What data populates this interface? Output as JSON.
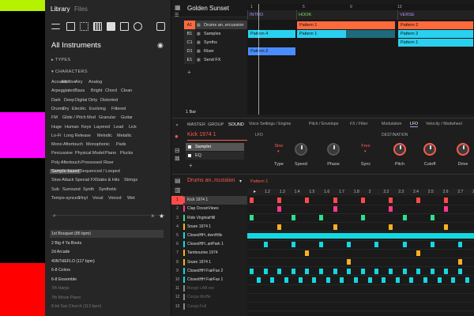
{
  "strip": {
    "colors": [
      "#b6f100",
      "#000000",
      "#ff00ff",
      "#000000",
      "#ff0000",
      "#000000"
    ]
  },
  "library": {
    "tabs": [
      "Library",
      "Files"
    ],
    "title": "All Instruments",
    "types_label": "TYPES",
    "characters_label": "CHARACTERS",
    "tags": [
      [
        "Acoustic",
        "Additive",
        "Airy",
        "Analog"
      ],
      [
        "Arpeggiated",
        "Bass",
        "Bright",
        "Chord",
        "Clean"
      ],
      [
        "Dark",
        "Deep",
        "Digital",
        "Dirty",
        "Distorted"
      ],
      [
        "Drums",
        "Dry",
        "Electric",
        "Evolving",
        "Filtered"
      ],
      [
        "FM",
        "Glide / Pitch Mod",
        "Granular",
        "Guitar"
      ],
      [
        "Huge",
        "Human",
        "Keys",
        "Layered",
        "Lead",
        "Lick"
      ],
      [
        "Lo-Fi",
        "Long Release",
        "Melodic",
        "Metallic"
      ],
      [
        "Mono Aftertouch",
        "Monophonic",
        "Pads"
      ],
      [
        "Percussive",
        "Physical Model",
        "Piano",
        "Plucks"
      ],
      [
        "Poly Aftertouch",
        "Processed",
        "Riser"
      ],
      [
        "Sample-based",
        "Sequenced / Looped"
      ],
      [
        "Slow Attack",
        "Special FX",
        "Stabs & Hits",
        "Strings"
      ],
      [
        "Sub",
        "Surround",
        "Synth",
        "Synthetic"
      ],
      [
        "Tempo-synced",
        "Vinyl",
        "Vocal",
        "Voiced",
        "Wet"
      ]
    ],
    "selected_tag": "Sample-based",
    "results": [
      {
        "name": "1st Bouquet (85 bpm)",
        "dim": false,
        "sel": true
      },
      {
        "name": "2 Big 4 Ya Boots",
        "dim": false
      },
      {
        "name": "2d Arcade",
        "dim": false
      },
      {
        "name": "40NTHEFLO (117 bpm)",
        "dim": false
      },
      {
        "name": "6-8 Colors",
        "dim": false
      },
      {
        "name": "6-8 Ensemble",
        "dim": false
      },
      {
        "name": "7th Harps",
        "dim": true
      },
      {
        "name": "7th Movie Piano",
        "dim": true
      },
      {
        "name": "8-bit Sax Church (113 bpm)",
        "dim": true
      }
    ]
  },
  "arranger": {
    "project": "Golden Sunset",
    "tracks": [
      {
        "id": "A1",
        "name": "Drums an..ercussion",
        "color": "#ff6a3d",
        "sel": true
      },
      {
        "id": "B1",
        "name": "Samples",
        "color": "#2ad0f0"
      },
      {
        "id": "C1",
        "name": "Synths",
        "color": "#2ad0f0"
      },
      {
        "id": "D1",
        "name": "Riser",
        "color": "#4a8cff"
      },
      {
        "id": "E1",
        "name": "Send FX",
        "color": "#555555"
      }
    ],
    "sections": [
      "INTRO",
      "HOOK",
      "VERSE"
    ],
    "ruler": [
      "1",
      "5",
      "9",
      "13"
    ],
    "clips": [
      {
        "label": "Pattern 1",
        "row": 0,
        "sec": 1,
        "color": "#ff6a3d"
      },
      {
        "label": "Pattern 2",
        "row": 0,
        "sec": 2,
        "color": "#ff6a3d"
      },
      {
        "label": "Pattern 4",
        "row": 1,
        "sec": 0,
        "color": "#2ad0f0"
      },
      {
        "label": "Pattern 1",
        "row": 1,
        "sec": 1,
        "color": "#2ad0f0"
      },
      {
        "label": "Pattern 2",
        "row": 1,
        "sec": 2,
        "color": "#2ad0f0"
      },
      {
        "label": "Pattern 1",
        "row": 2,
        "sec": 2,
        "color": "#2ad0f0"
      },
      {
        "label": "Pattern 2",
        "row": 3,
        "sec": 0,
        "color": "#4a8cff"
      }
    ],
    "length": "1 Bar"
  },
  "sound": {
    "tabs": [
      "MASTER",
      "GROUP",
      "SOUND"
    ],
    "name": "Kick 1974 1",
    "plugins": [
      "Sampler",
      "EQ"
    ],
    "param_tabs": [
      "Voice Settings / Engine",
      "Pitch / Envelope",
      "FX / Filter",
      "Modulation",
      "LFO",
      "Velocity / Modwheel"
    ],
    "active_param": "LFO",
    "lfo_label": "LFO",
    "dest_label": "DESTINATION",
    "knobs": [
      {
        "label": "Type",
        "value": "Sine"
      },
      {
        "label": "Speed",
        "value": ""
      },
      {
        "label": "Phase",
        "value": ""
      },
      {
        "label": "Sync",
        "value": "Free"
      },
      {
        "label": "Pitch",
        "value": ""
      },
      {
        "label": "Cutoff",
        "value": ""
      },
      {
        "label": "Drive",
        "value": ""
      }
    ]
  },
  "pattern": {
    "group": "Drums an..rcussion",
    "name": "Pattern 1",
    "ruler": [
      "1.2",
      "1.3",
      "1.4",
      "1.5",
      "1.6",
      "1.7",
      "1.8",
      "2",
      "2.2",
      "2.3",
      "2.4",
      "2.5",
      "2.6",
      "2.7",
      "2.8"
    ],
    "pads": [
      {
        "n": "1",
        "name": "Kick 1974 1",
        "color": "#ff4a4a",
        "steps": [
          0,
          4,
          8,
          12,
          16,
          20,
          24,
          28
        ]
      },
      {
        "n": "2",
        "name": "Clap OceanViews",
        "color": "#ff3a8c",
        "steps": [
          4,
          12,
          20,
          28
        ]
      },
      {
        "n": "3",
        "name": "Ride VirginiaHill",
        "color": "#2ee08a",
        "steps": [
          0,
          6,
          10,
          16,
          22,
          26
        ]
      },
      {
        "n": "4",
        "name": "Snare 1974 1",
        "color": "#ffb020",
        "steps": [
          4,
          12,
          20,
          28
        ]
      },
      {
        "n": "5",
        "name": "ClosedHH..dwnHills",
        "color": "#14d8e0",
        "steps": "full"
      },
      {
        "n": "6",
        "name": "ClosedHH..artPark 1",
        "color": "#14d8e0",
        "steps": [
          2,
          6,
          10,
          14,
          18,
          22,
          26,
          30
        ]
      },
      {
        "n": "7",
        "name": "Tambourine 1974",
        "color": "#ffb020",
        "steps": [
          8,
          24
        ]
      },
      {
        "n": "8",
        "name": "Snare 1974 1",
        "color": "#ffb020",
        "steps": [
          14,
          30
        ]
      },
      {
        "n": "9",
        "name": "ClosedHH FairFax 2",
        "color": "#14d8e0",
        "steps": [
          0,
          2,
          4,
          6,
          8,
          10,
          12,
          14,
          16,
          18,
          20,
          22,
          24,
          26,
          28,
          30
        ]
      },
      {
        "n": "10",
        "name": "ClosedHH FairFax 1",
        "color": "#14d8e0",
        "steps": [
          1,
          3,
          5,
          7,
          9,
          11,
          13,
          15,
          17,
          19,
          21,
          23,
          25,
          27,
          29,
          31
        ]
      },
      {
        "n": "11",
        "name": "Bongo LAB-ree",
        "color": "#888888",
        "steps": []
      },
      {
        "n": "12",
        "name": "Conga Muffle",
        "color": "#888888",
        "steps": []
      },
      {
        "n": "13",
        "name": "Conga Full",
        "color": "#888888",
        "steps": []
      }
    ]
  }
}
